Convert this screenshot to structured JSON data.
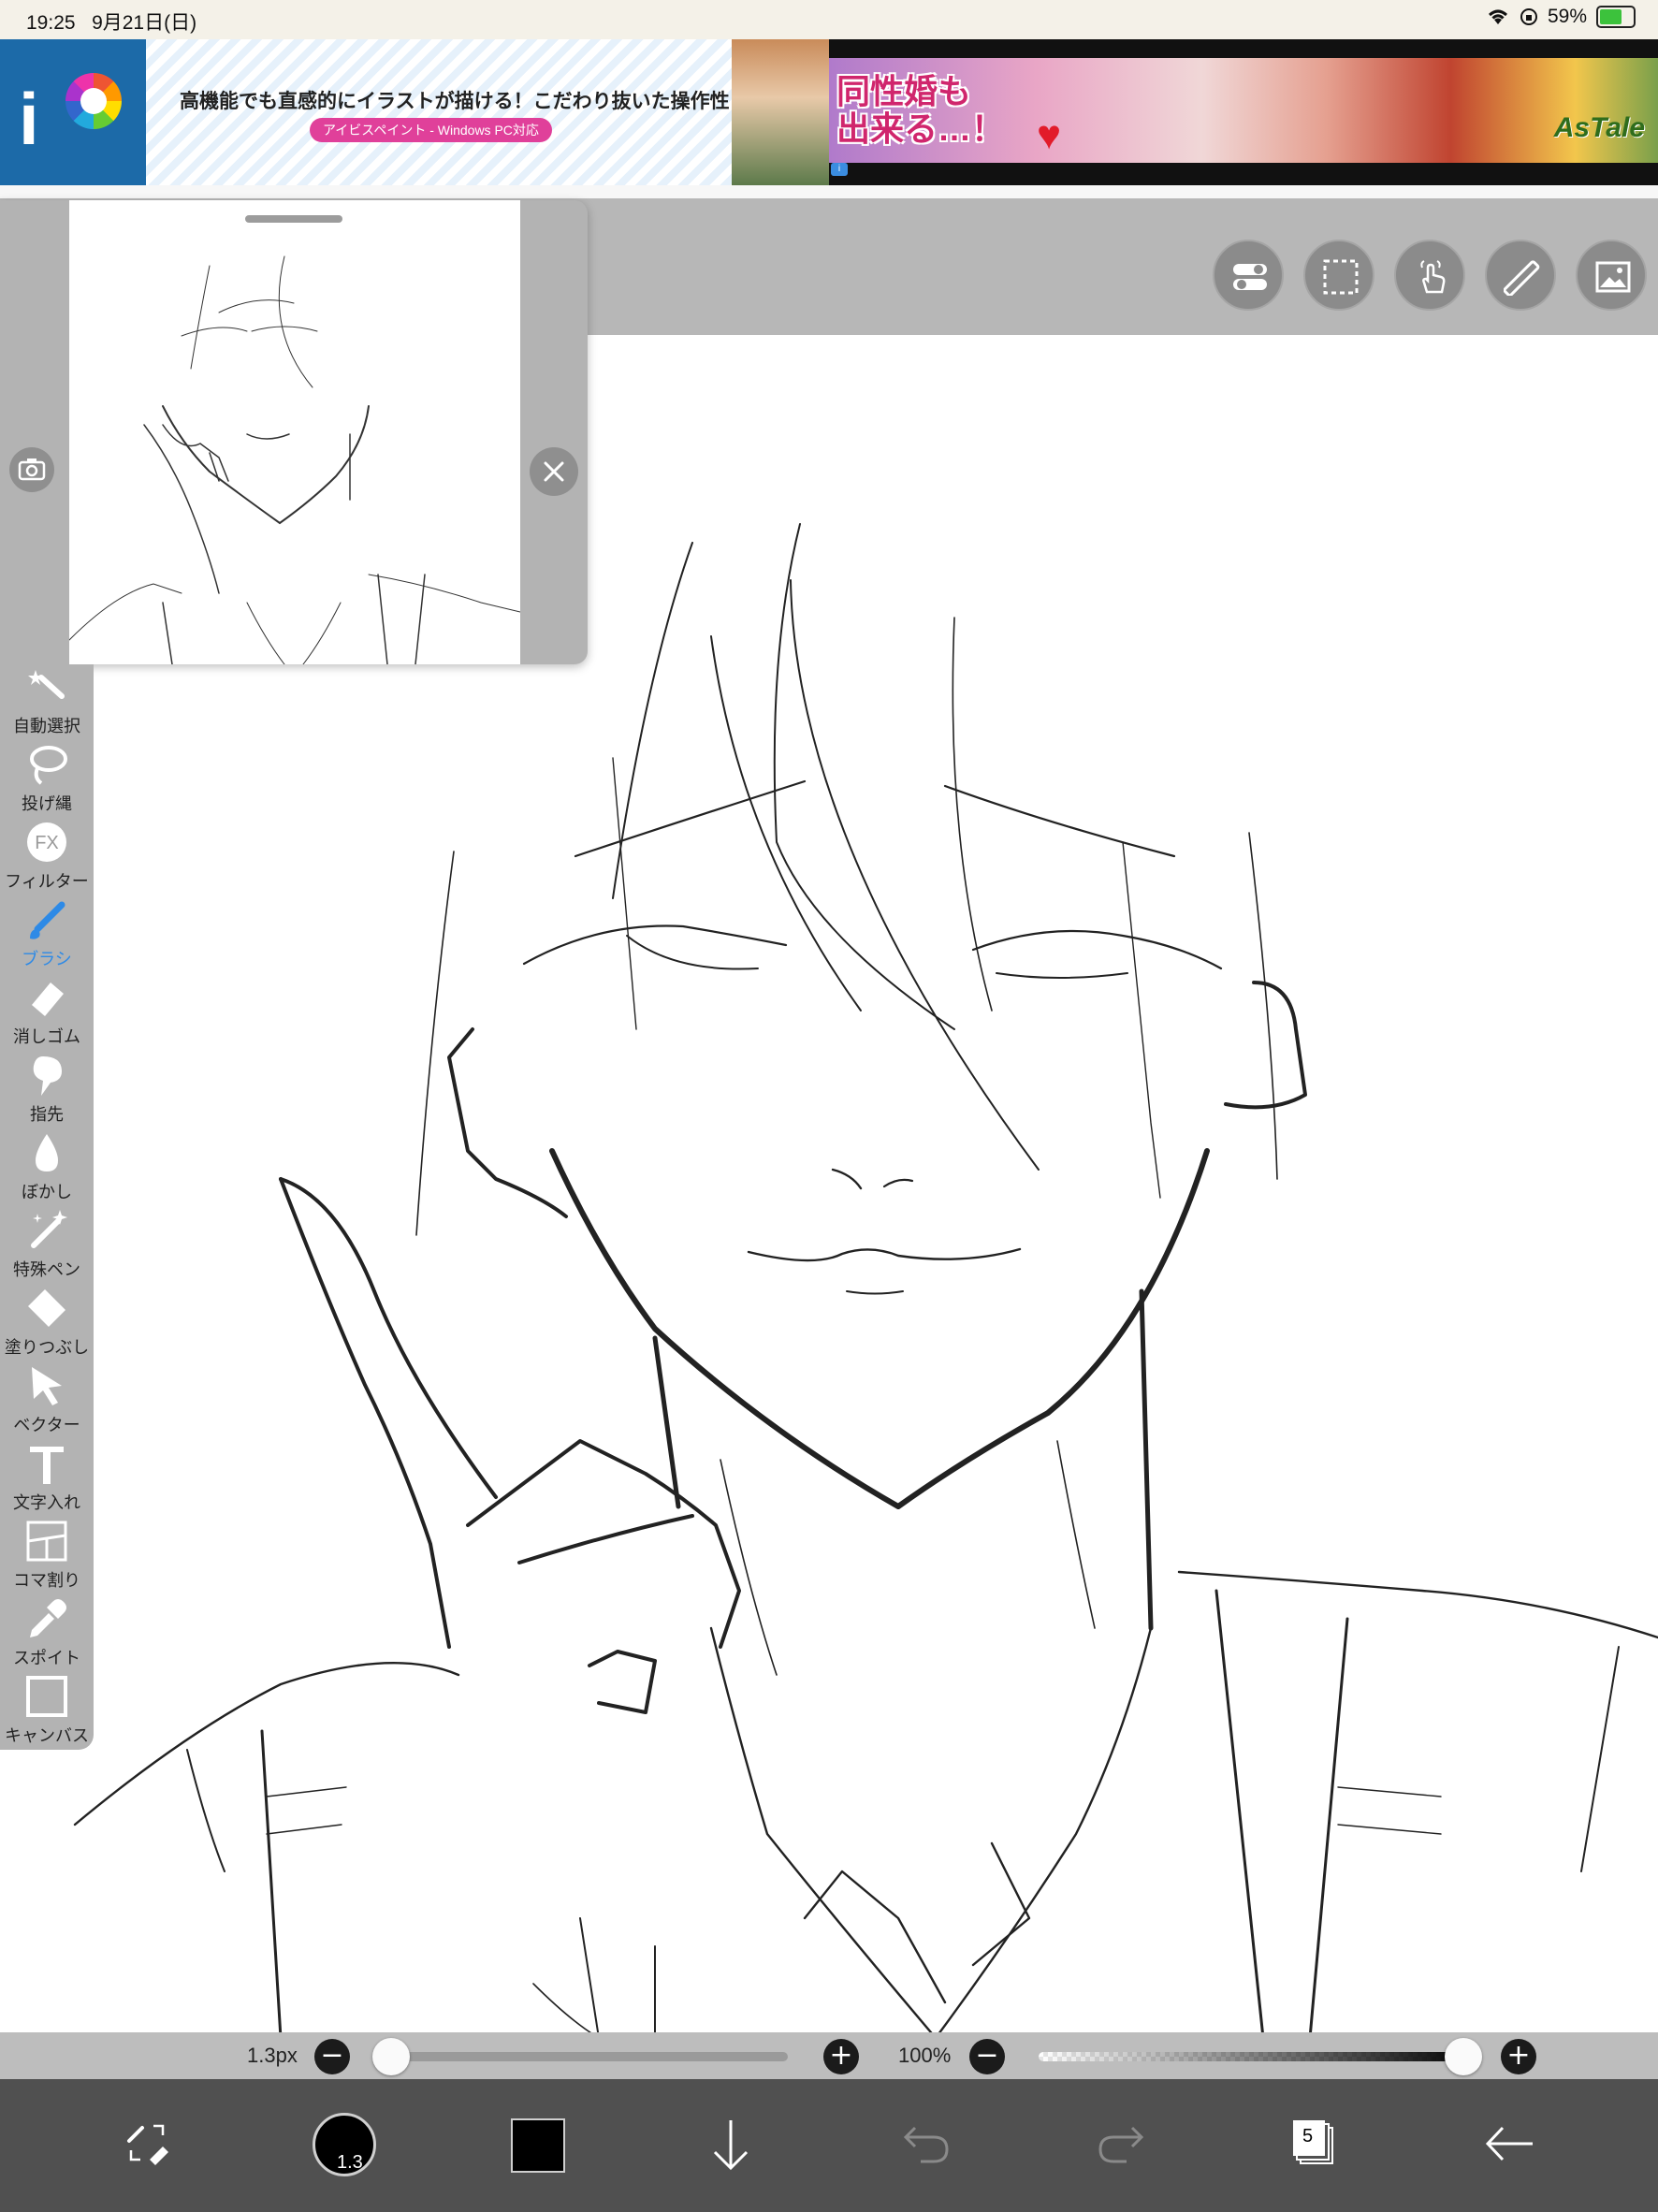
{
  "status_bar": {
    "time": "19:25",
    "date": "9月21日(日)",
    "battery_percent": "59%",
    "battery_level": 0.59
  },
  "ad": {
    "headline": "高機能でも直感的にイラストが描ける！こだわり抜いた操作性！",
    "pill": "アイビスペイント - Windows PC対応",
    "game_copy_line1": "同性婚も",
    "game_copy_line2": "出来る…！",
    "game_brand": "AsTale"
  },
  "top_toolbar": {
    "buttons": [
      "toggle-icon",
      "selection-icon",
      "gesture-icon",
      "ruler-icon",
      "image-icon"
    ]
  },
  "left_toolbar": {
    "items": [
      {
        "label": "自動選択",
        "icon": "magic-wand-icon"
      },
      {
        "label": "投げ縄",
        "icon": "lasso-icon"
      },
      {
        "label": "フィルター",
        "icon": "fx-icon"
      },
      {
        "label": "ブラシ",
        "icon": "brush-icon",
        "active": true
      },
      {
        "label": "消しゴム",
        "icon": "eraser-icon"
      },
      {
        "label": "指先",
        "icon": "smudge-icon"
      },
      {
        "label": "ぼかし",
        "icon": "blur-icon"
      },
      {
        "label": "特殊ペン",
        "icon": "special-pen-icon"
      },
      {
        "label": "塗りつぶし",
        "icon": "fill-icon"
      },
      {
        "label": "ベクター",
        "icon": "vector-icon"
      },
      {
        "label": "文字入れ",
        "icon": "text-icon"
      },
      {
        "label": "コマ割り",
        "icon": "frame-divider-icon"
      },
      {
        "label": "スポイト",
        "icon": "eyedropper-icon"
      },
      {
        "label": "キャンバス",
        "icon": "canvas-icon"
      }
    ]
  },
  "sliders": {
    "brush_size_label": "1.3px",
    "brush_size_fraction": 0.0,
    "opacity_label": "100%",
    "opacity_fraction": 1.0
  },
  "bottom_bar": {
    "brush_size_badge": "1.3",
    "layer_count": "5",
    "color": "#000000"
  },
  "colors": {
    "accent": "#2e8ae6",
    "toolbar_gray": "#b3b3b3",
    "bottom_bar": "#505050"
  }
}
